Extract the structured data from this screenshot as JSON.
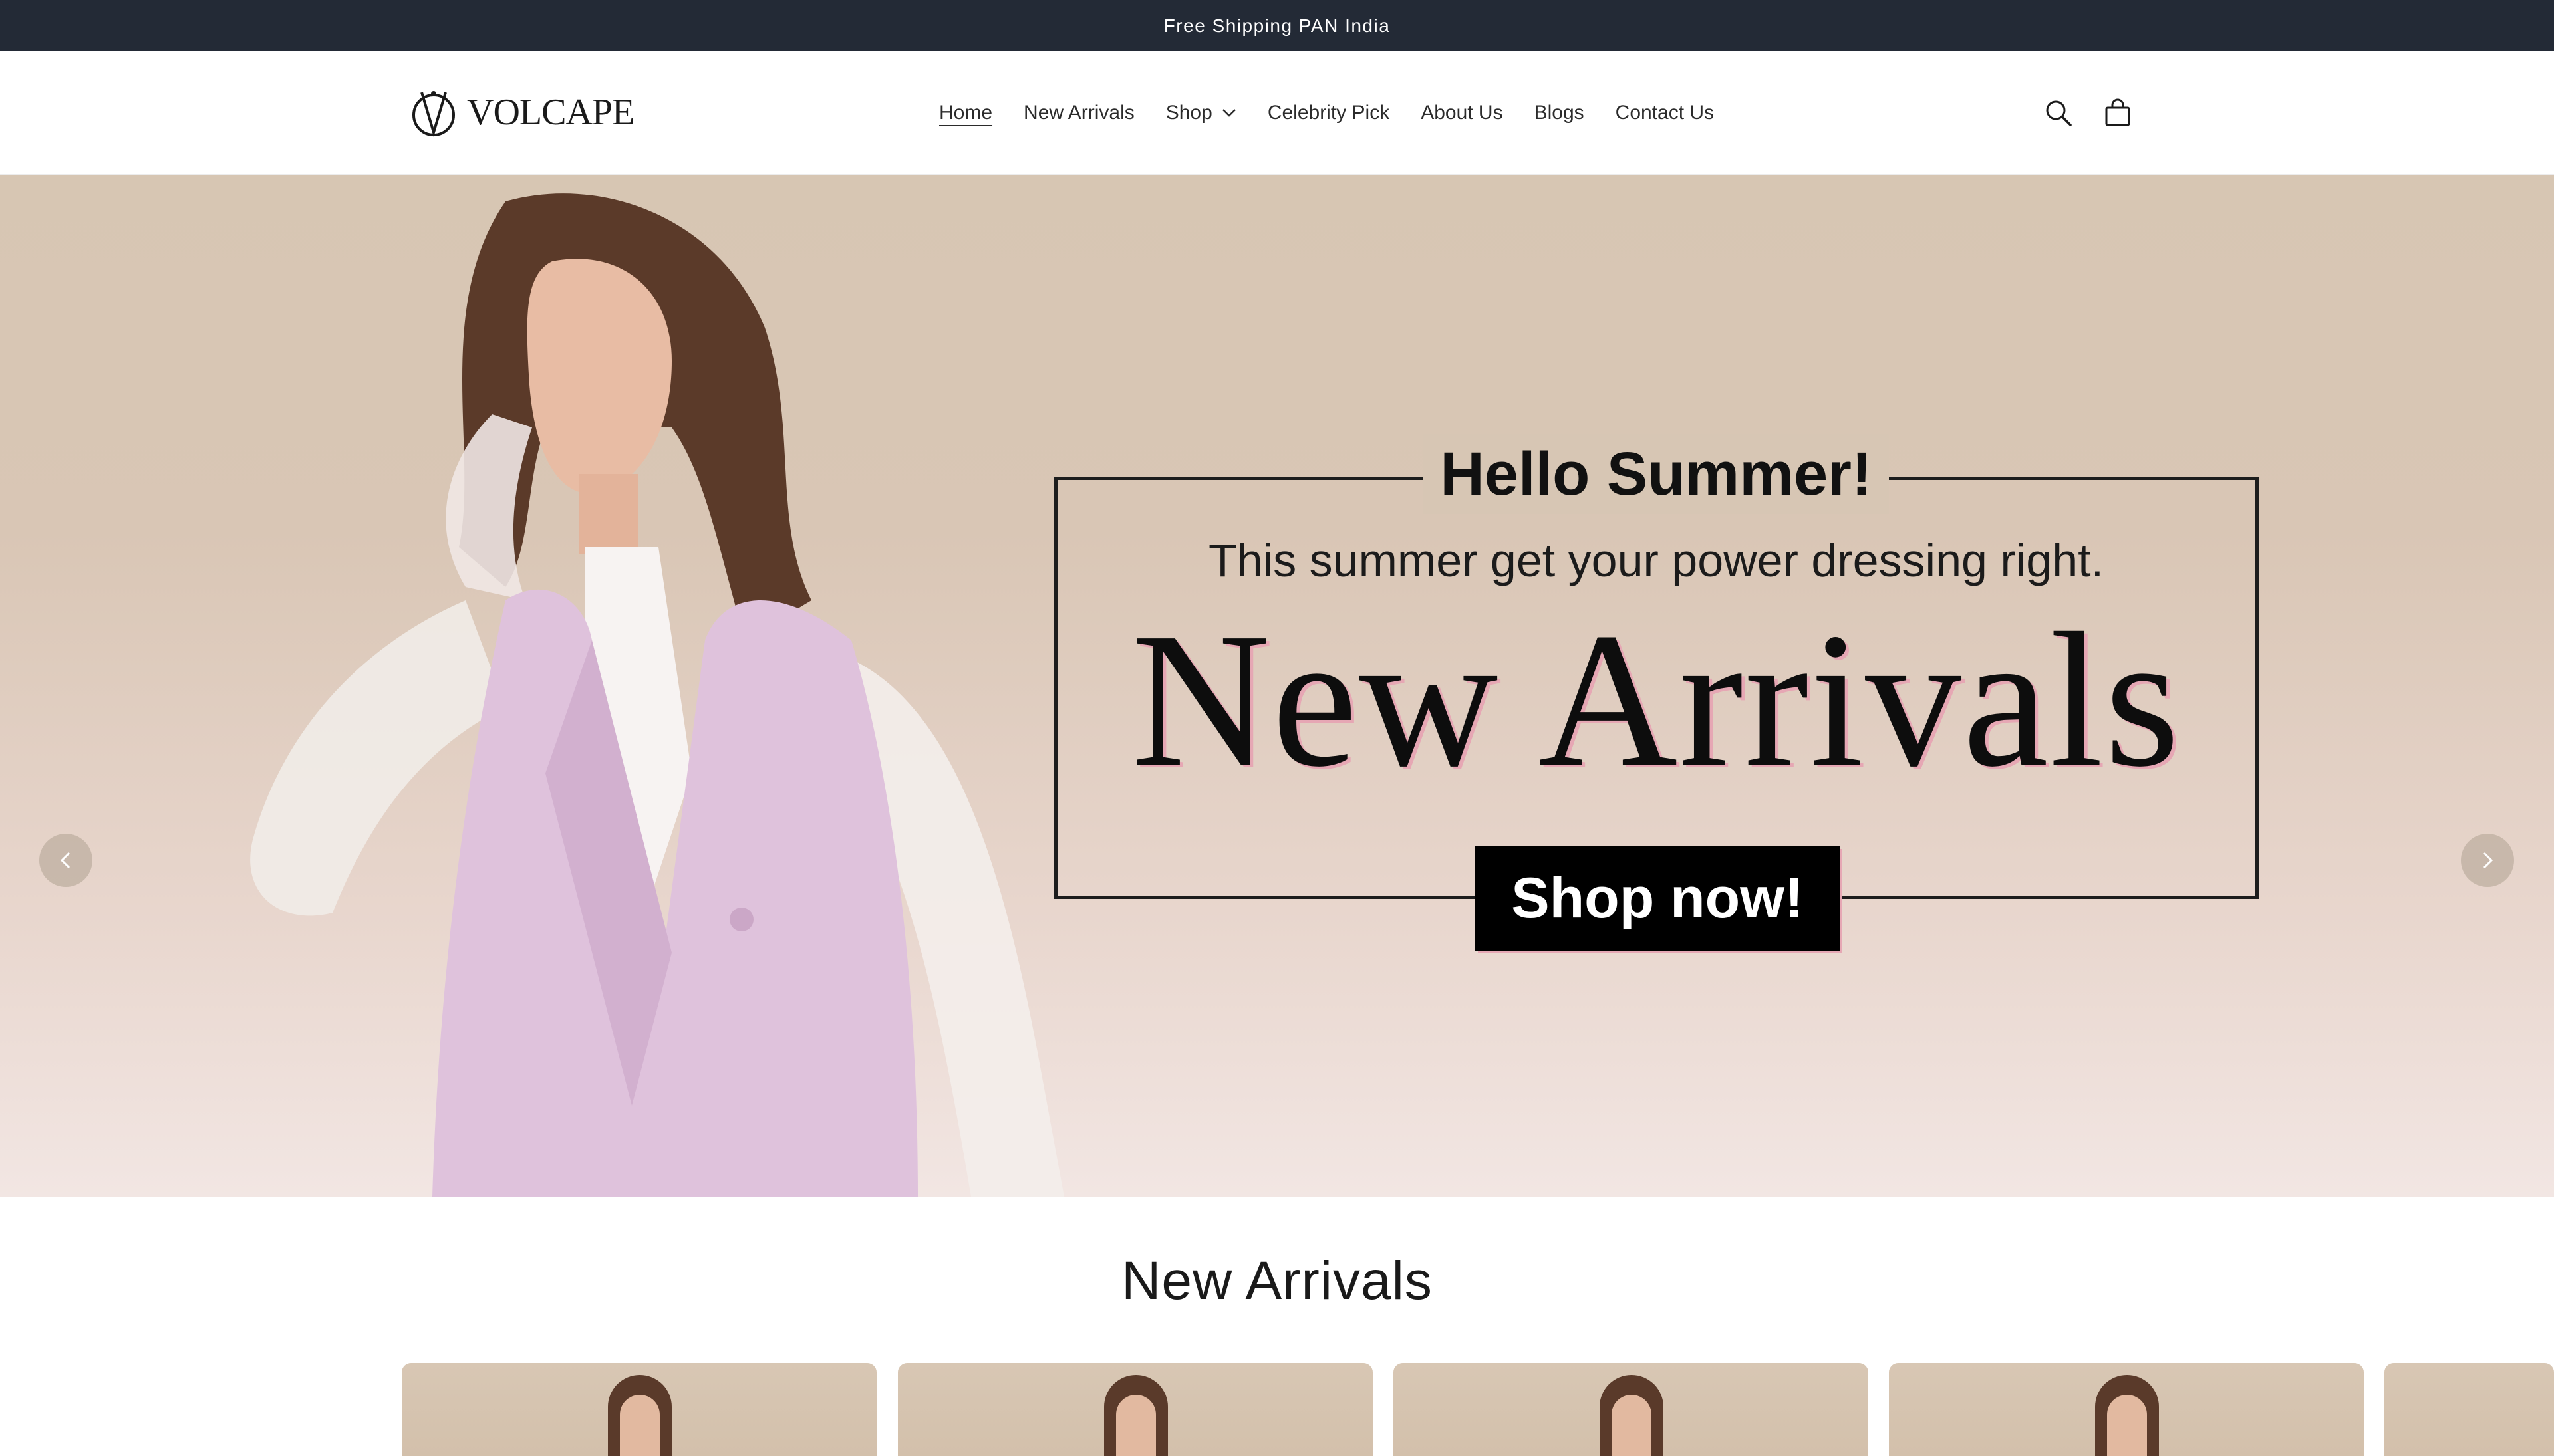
{
  "announcement": {
    "text": "Free Shipping PAN India"
  },
  "brand": {
    "logo_text": "VOLCAPE"
  },
  "nav": {
    "items": [
      {
        "label": "Home",
        "active": true
      },
      {
        "label": "New Arrivals"
      },
      {
        "label": "Shop",
        "has_dropdown": true
      },
      {
        "label": "Celebrity Pick"
      },
      {
        "label": "About Us"
      },
      {
        "label": "Blogs"
      },
      {
        "label": "Contact Us"
      }
    ]
  },
  "header_icons": {
    "search": "search-icon",
    "cart": "cart-icon"
  },
  "hero": {
    "heading": "Hello Summer!",
    "subheading": "This summer get your power dressing right.",
    "title": "New Arrivals",
    "cta": "Shop now!",
    "accent_color": "#e6a7b4",
    "prev_icon": "chevron-left-icon",
    "next_icon": "chevron-right-icon"
  },
  "new_arrivals": {
    "title": "New Arrivals",
    "cards": [
      {},
      {},
      {},
      {},
      {}
    ]
  },
  "colors": {
    "announcement_bg": "#232a36",
    "hero_bg": "#d7c6b3"
  }
}
